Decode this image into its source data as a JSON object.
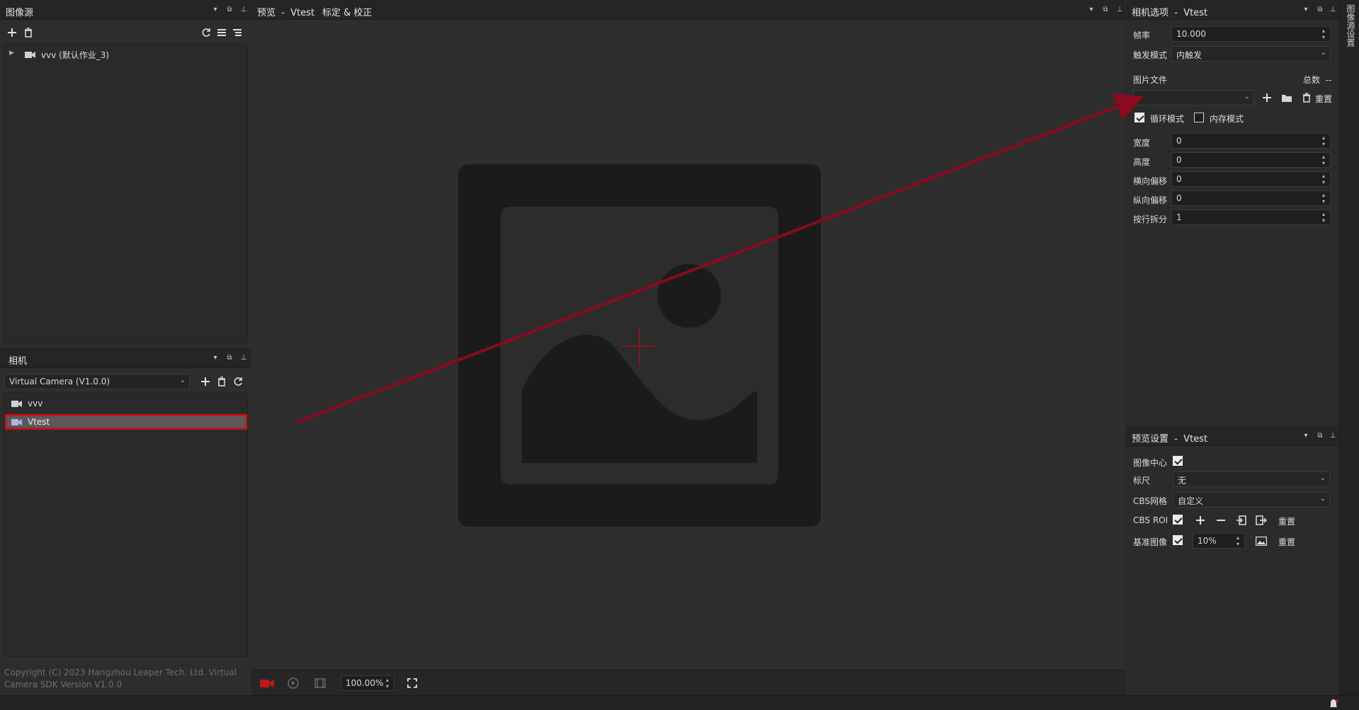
{
  "left_top_panel": {
    "title": "图像源",
    "tree_items": [
      {
        "label": "vvv (默认作业_3)"
      }
    ]
  },
  "left_bottom_panel": {
    "title": "相机",
    "camera_select": "Virtual Camera (V1.0.0)",
    "cameras": [
      {
        "label": "vvv",
        "selected": false
      },
      {
        "label": "Vtest",
        "selected": true
      }
    ],
    "copyright": "Copyright (C) 2023 Hangzhou Leaper Tech. Ltd. Virtual Camera SDK Version V1.0.0"
  },
  "center_panel": {
    "tab_preview": "预览",
    "tab_sep": "-",
    "tab_name": "Vtest",
    "tab_calibration": "标定 & 校正",
    "zoom": "100.00%"
  },
  "camera_options": {
    "title": "相机选项",
    "title_sep": "-",
    "title_name": "Vtest",
    "frame_rate_label": "帧率",
    "frame_rate_value": "10.000",
    "trigger_label": "触发模式",
    "trigger_value": "内触发",
    "image_files_label": "图片文件",
    "total_label": "总数",
    "total_value": "--",
    "file_select_value": "",
    "reset_label": "重置",
    "loop_mode_label": "循环模式",
    "loop_mode_checked": true,
    "memory_mode_label": "内存模式",
    "memory_mode_checked": false,
    "width_label": "宽度",
    "width_value": "0",
    "height_label": "高度",
    "height_value": "0",
    "h_offset_label": "横向偏移",
    "h_offset_value": "0",
    "v_offset_label": "纵向偏移",
    "v_offset_value": "0",
    "row_split_label": "按行拆分",
    "row_split_value": "1"
  },
  "preview_settings": {
    "title": "预览设置",
    "title_sep": "-",
    "title_name": "Vtest",
    "image_center_label": "图像中心",
    "image_center_checked": true,
    "ruler_label": "标尺",
    "ruler_value": "无",
    "cbs_grid_label": "CBS网格",
    "cbs_grid_value": "自定义",
    "cbs_roi_label": "CBS ROI",
    "cbs_roi_checked": true,
    "cbs_roi_reset": "重置",
    "ref_image_label": "基准图像",
    "ref_image_checked": true,
    "ref_image_percent": "10%",
    "ref_image_reset": "重置"
  },
  "side_tab": {
    "label": "图像源设置"
  },
  "colors": {
    "accent_red": "#c0171b",
    "arrow": "#8b0a1e",
    "selected_row": "#5a5a5a"
  }
}
